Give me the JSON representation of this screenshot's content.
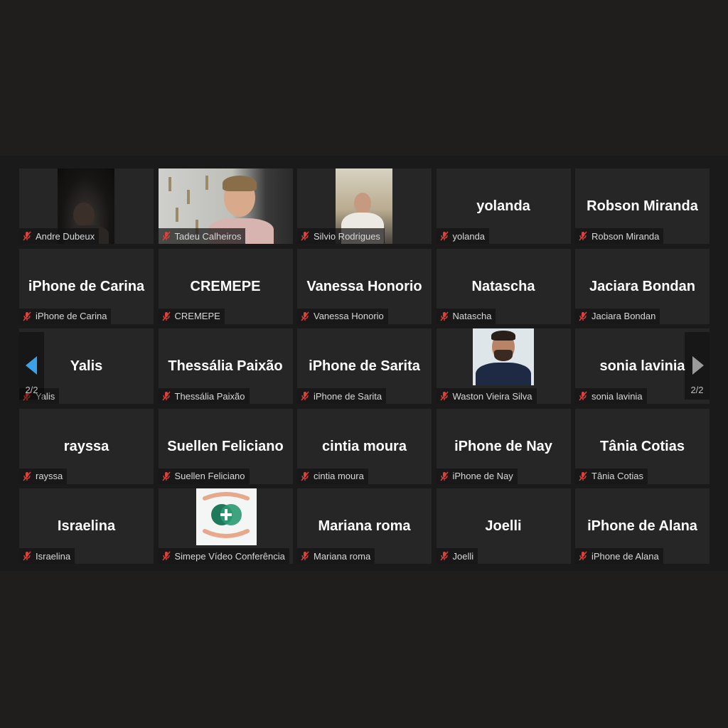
{
  "pagination": {
    "left": "2/2",
    "right": "2/2"
  },
  "colors": {
    "background": "#1f1e1d",
    "tile": "#262626",
    "muted_mic": "#e0413a",
    "nav_arrow_left": "#3aa0e8"
  },
  "participants": [
    {
      "label": "Andre Dubeux",
      "display": "",
      "video": true
    },
    {
      "label": "Tadeu Calheiros",
      "display": "",
      "video": true
    },
    {
      "label": "Silvio Rodrigues",
      "display": "",
      "video": true
    },
    {
      "label": "yolanda",
      "display": "yolanda",
      "video": false
    },
    {
      "label": "Robson Miranda",
      "display": "Robson Miranda",
      "video": false
    },
    {
      "label": "iPhone de Carina",
      "display": "iPhone de Carina",
      "video": false
    },
    {
      "label": "CREMEPE",
      "display": "CREMEPE",
      "video": false
    },
    {
      "label": "Vanessa Honorio",
      "display": "Vanessa Honorio",
      "video": false
    },
    {
      "label": "Natascha",
      "display": "Natascha",
      "video": false
    },
    {
      "label": "Jaciara Bondan",
      "display": "Jaciara Bondan",
      "video": false
    },
    {
      "label": "Yalis",
      "display": "Yalis",
      "video": false
    },
    {
      "label": "Thessália Paixão",
      "display": "Thessália Paixão",
      "video": false
    },
    {
      "label": "iPhone de Sarita",
      "display": "iPhone de Sarita",
      "video": false
    },
    {
      "label": "Waston Vieira Silva",
      "display": "",
      "video": true
    },
    {
      "label": "sonia lavinia",
      "display": "sonia lavinia",
      "video": false
    },
    {
      "label": "rayssa",
      "display": "rayssa",
      "video": false
    },
    {
      "label": "Suellen Feliciano",
      "display": "Suellen Feliciano",
      "video": false
    },
    {
      "label": "cintia moura",
      "display": "cintia moura",
      "video": false
    },
    {
      "label": "iPhone de Nay",
      "display": "iPhone de Nay",
      "video": false
    },
    {
      "label": "Tânia Cotias",
      "display": "Tânia Cotias",
      "video": false
    },
    {
      "label": "Israelina",
      "display": "Israelina",
      "video": false
    },
    {
      "label": "Simepe Vídeo Conferência",
      "display": "",
      "video": true
    },
    {
      "label": "Mariana roma",
      "display": "Mariana roma",
      "video": false
    },
    {
      "label": "Joelli",
      "display": "Joelli",
      "video": false
    },
    {
      "label": "iPhone de Alana",
      "display": "iPhone de Alana",
      "video": false
    }
  ]
}
